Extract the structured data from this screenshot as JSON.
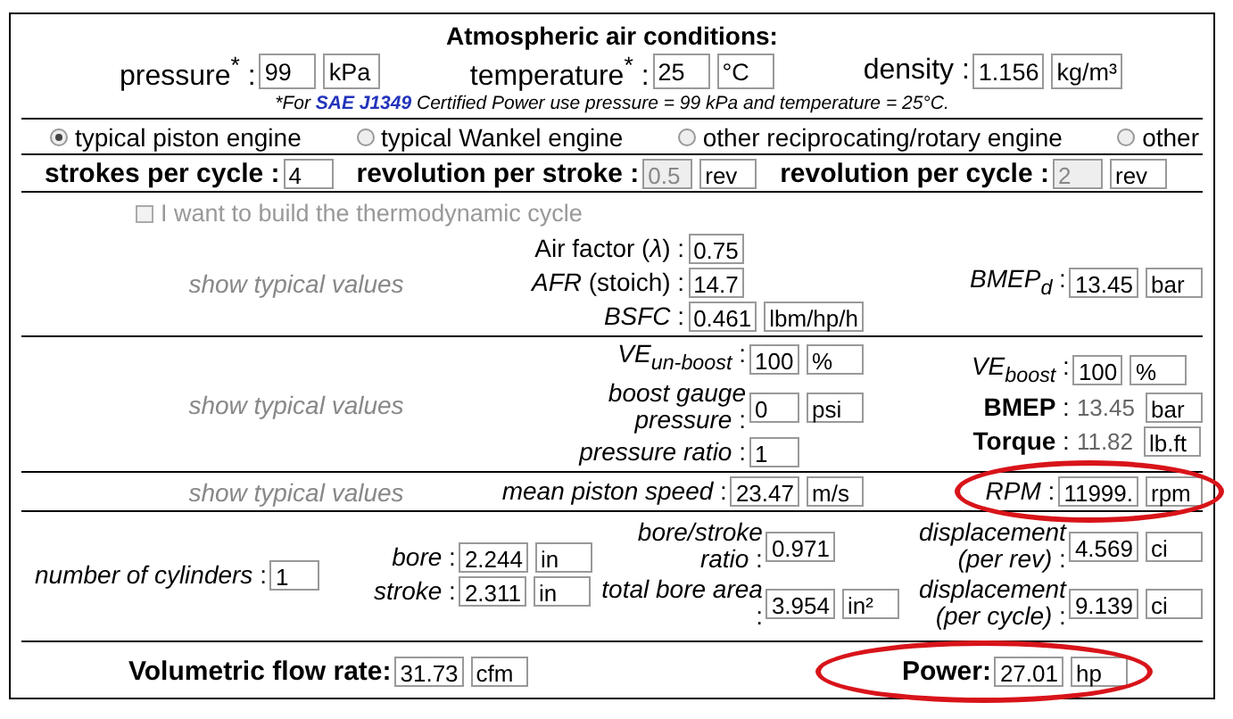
{
  "header": {
    "title": "Atmospheric air conditions:",
    "fields": [
      {
        "label": "pressure$^{*}$ :",
        "value": "99",
        "unit": "kPa",
        "kind": "input"
      },
      {
        "label": "temperature$^{*}$ :",
        "value": "25",
        "unit": "°C",
        "kind": "input"
      },
      {
        "label": "density :",
        "value": "1.156",
        "unit": "kg/m³",
        "kind": "input"
      }
    ],
    "note": {
      "before": "*For ",
      "link": "SAE J1349",
      "after": " Certified Power use pressure = 99 kPa and temperature = 25°C."
    }
  },
  "engine_types": [
    {
      "label": "typical piston engine",
      "selected": true
    },
    {
      "label": "typical Wankel engine",
      "selected": false
    },
    {
      "label": "other reciprocating/rotary engine",
      "selected": false
    },
    {
      "label": "other",
      "selected": false
    }
  ],
  "cycle": [
    {
      "label": "strokes per cycle :",
      "value": "4",
      "kind": "input"
    },
    {
      "label": "revolution per stroke :",
      "value": "0.5",
      "unit": "rev",
      "kind": "readonly"
    },
    {
      "label": "revolution per cycle :",
      "value": "2",
      "unit": "rev",
      "kind": "readonly"
    }
  ],
  "thermo_checkbox": {
    "label": "I want to build the thermodynamic cycle",
    "checked": false,
    "disabled": true
  },
  "sections": [
    {
      "kind": "typical",
      "link": "show typical values",
      "groups": [
        [
          {
            "label": "Air factor (*λ*) :",
            "value": "0.75",
            "kind": "input"
          },
          {
            "label": "*AFR* (stoich) :",
            "value": "14.7",
            "kind": "input"
          },
          {
            "label": "*BSFC* :",
            "value": "0.461",
            "unit": "lbm/hp/h",
            "kind": "input"
          }
        ],
        [
          {
            "label": "*BMEP$_{d}$* :",
            "value": "13.45",
            "unit": "bar",
            "kind": "input"
          }
        ]
      ]
    },
    {
      "kind": "typical",
      "link": "show typical values",
      "groups": [
        [
          {
            "label": "*VE$_{un-boost}$* :",
            "value": "100",
            "unit": "%",
            "kind": "input"
          },
          {
            "label": "*boost gauge pressure* :",
            "value": "0",
            "unit": "psi",
            "kind": "input"
          },
          {
            "label": "*pressure ratio* :",
            "value": "1",
            "kind": "input"
          }
        ],
        [
          {
            "label": "*VE$_{boost}$* :",
            "value": "100",
            "unit": "%",
            "kind": "input"
          },
          {
            "label": "**BMEP** :",
            "value": "13.45",
            "unit": "bar",
            "kind": "text"
          },
          {
            "label": "**Torque** :",
            "value": "11.82",
            "unit": "lb.ft",
            "kind": "text"
          }
        ]
      ]
    },
    {
      "kind": "typical",
      "link": "show typical values",
      "groups": [
        [
          {
            "label": "*mean piston speed* :",
            "value": "23.47",
            "unit": "m/s",
            "kind": "input"
          }
        ],
        [
          {
            "label": "*RPM* :",
            "value": "11999.",
            "unit": "rpm",
            "kind": "input",
            "circled": true
          }
        ]
      ]
    },
    {
      "kind": "geometry",
      "groups": [
        [
          {
            "label": "*number of cylinders* :",
            "value": "1",
            "kind": "input"
          }
        ],
        [
          {
            "label": "*bore* :",
            "value": "2.244",
            "unit": "in",
            "kind": "input"
          },
          {
            "label": "*stroke* :",
            "value": "2.311",
            "unit": "in",
            "kind": "input"
          }
        ],
        [
          {
            "label": "*bore/stroke ratio* :",
            "value": "0.971",
            "kind": "input"
          },
          {
            "label": "*total bore area* :",
            "value": "3.954",
            "unit": "in²",
            "kind": "input"
          }
        ],
        [
          {
            "label": "*displacement (per rev)* :",
            "value": "4.569",
            "unit": "ci",
            "kind": "input"
          },
          {
            "label": "*displacement (per cycle)* :",
            "value": "9.139",
            "unit": "ci",
            "kind": "input"
          }
        ]
      ]
    }
  ],
  "footer": [
    {
      "label": "Volumetric flow rate:",
      "value": "31.73",
      "unit": "cfm",
      "kind": "input"
    },
    {
      "label": "Power:",
      "value": "27.01",
      "unit": "hp",
      "kind": "input",
      "circled": true
    }
  ]
}
